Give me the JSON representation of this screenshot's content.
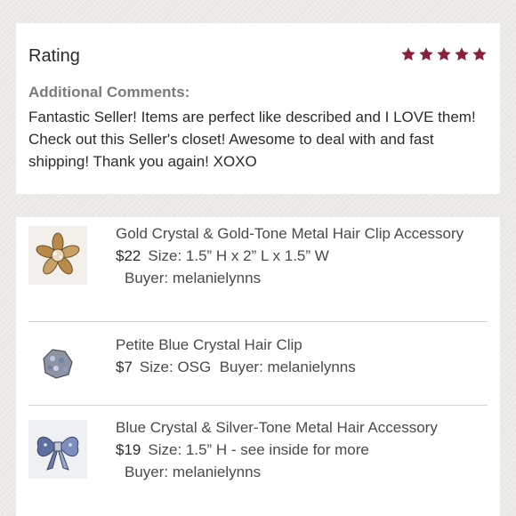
{
  "review": {
    "rating_label": "Rating",
    "rating_stars": 5,
    "star_color": "#8a1f3a",
    "comments_heading": "Additional Comments:",
    "comments_text": "Fantastic Seller! Items are perfect like described and I LOVE them! Check out this Seller's closet! Awesome to deal with and fast shipping! Thank you again! XOXO"
  },
  "items": [
    {
      "title": "Gold Crystal & Gold-Tone Metal Hair Clip Accessory",
      "price": "$22",
      "size": "Size: 1.5” H x 2” L x 1.5” W",
      "buyer": "Buyer: melanielynns",
      "thumb_icon": "gold-flower-clip-image"
    },
    {
      "title": "Petite Blue Crystal Hair Clip",
      "price": "$7",
      "size": "Size: OSG",
      "buyer": "Buyer: melanielynns",
      "thumb_icon": "blue-crystal-clip-image"
    },
    {
      "title": "Blue Crystal & Silver-Tone Metal Hair Accessory",
      "price": "$19",
      "size": "Size: 1.5” H - see inside for more",
      "buyer": "Buyer: melanielynns",
      "thumb_icon": "blue-bow-clip-image"
    }
  ]
}
